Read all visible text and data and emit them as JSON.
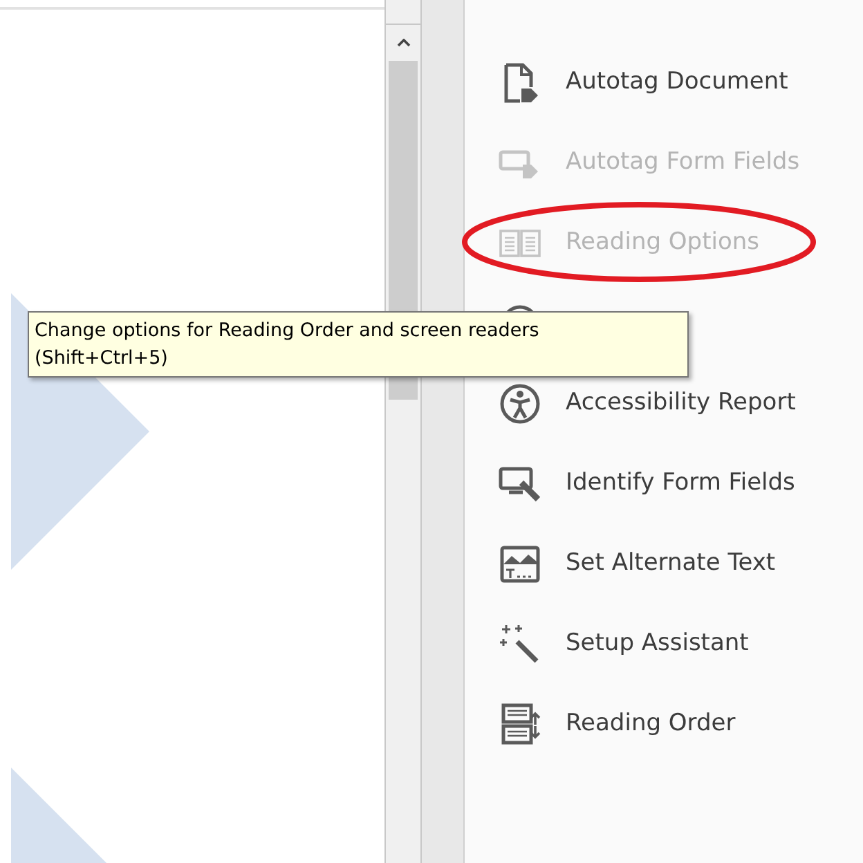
{
  "tools": [
    {
      "label": "Autotag Document",
      "disabled": false,
      "circled": false
    },
    {
      "label": "Autotag Form Fields",
      "disabled": true,
      "circled": false
    },
    {
      "label": "Reading Options",
      "disabled": true,
      "circled": true
    },
    {
      "disabled": false,
      "circled": false
    },
    {
      "label": "Accessibility Report",
      "disabled": false,
      "circled": false
    },
    {
      "label": "Identify Form Fields",
      "disabled": false,
      "circled": false
    },
    {
      "label": "Set Alternate Text",
      "disabled": false,
      "circled": false
    },
    {
      "label": "Setup Assistant",
      "disabled": false,
      "circled": false
    },
    {
      "label": "Reading Order",
      "disabled": false,
      "circled": false
    }
  ],
  "tooltip": {
    "lines": [
      "Change options for Reading Order and screen readers",
      "(Shift+Ctrl+5)"
    ]
  }
}
